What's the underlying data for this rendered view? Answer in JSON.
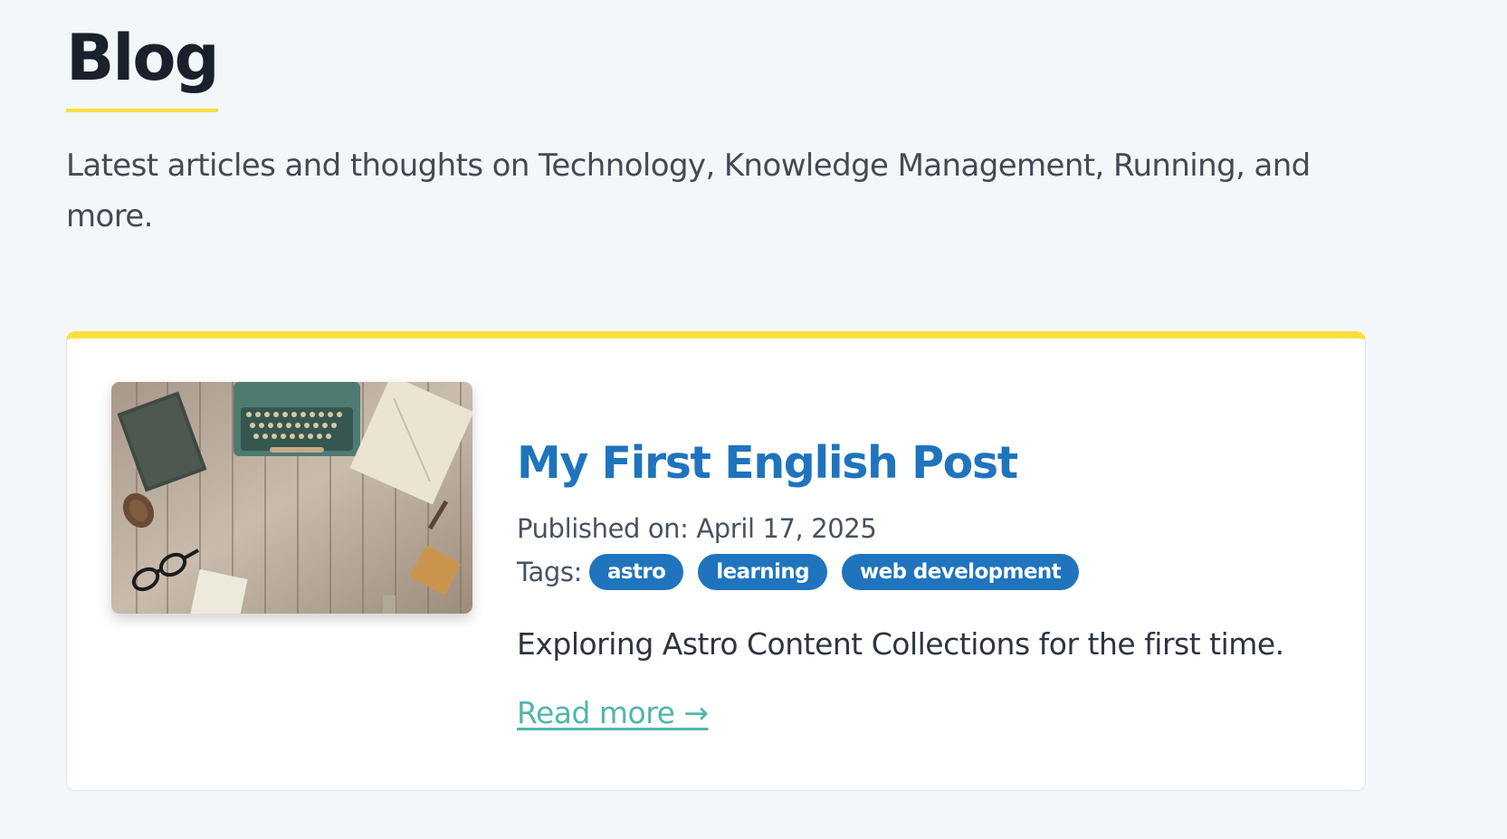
{
  "header": {
    "title": "Blog",
    "intro": "Latest articles and thoughts on Technology, Knowledge Management, Running, and more."
  },
  "posts": [
    {
      "thumbnail": "typewriter-desk-photo",
      "title": "My First English Post",
      "published": "Published on: April 17, 2025",
      "tags_label": "Tags:",
      "tags": [
        "astro",
        "learning",
        "web development"
      ],
      "excerpt": "Exploring Astro Content Collections for the first time.",
      "read_more": "Read more →"
    }
  ],
  "colors": {
    "background": "#f4f7fa",
    "accent": "#f7e03c",
    "link_blue": "#1f74bd",
    "read_more_teal": "#4fb6ad"
  }
}
